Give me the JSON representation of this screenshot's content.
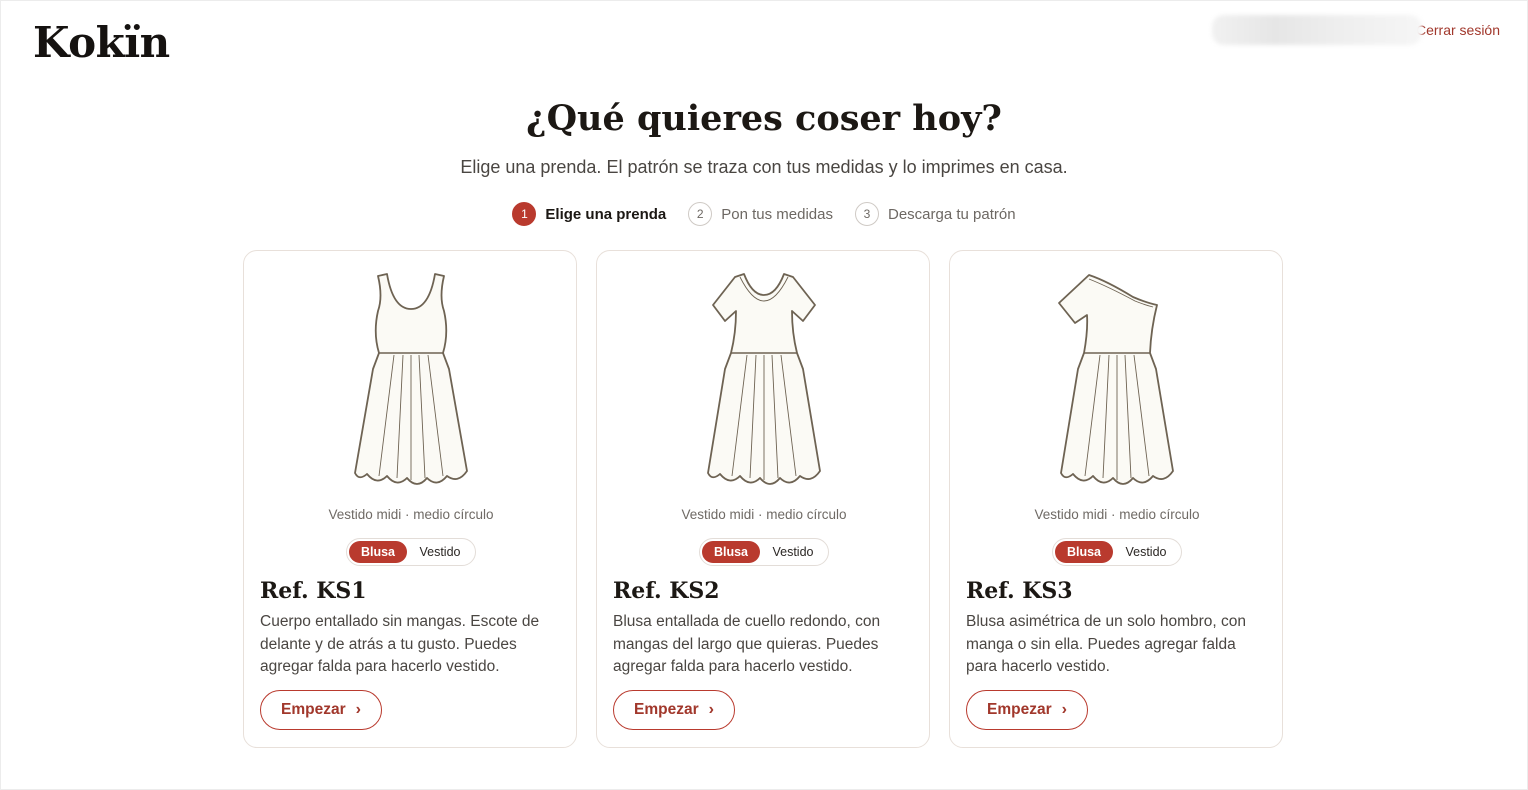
{
  "header": {
    "logo": "Kokïn",
    "logout_label": "Cerrar sesión"
  },
  "intro": {
    "title": "¿Qué quieres coser hoy?",
    "subtitle": "Elige una prenda. El patrón se traza con tus medidas y lo imprimes en casa."
  },
  "steps": [
    {
      "number": "1",
      "label": "Elige una prenda",
      "active": true
    },
    {
      "number": "2",
      "label": "Pon tus medidas",
      "active": false
    },
    {
      "number": "3",
      "label": "Descarga tu patrón",
      "active": false
    }
  ],
  "cards": [
    {
      "illustration": "sleeveless-dress-icon",
      "caption": "Vestido midi · medio círculo",
      "toggle": {
        "selected": "Blusa",
        "other": "Vestido"
      },
      "ref": "Ref. KS1",
      "description": "Cuerpo entallado sin mangas. Escote de delante y de atrás a tu gusto. Puedes agregar falda para hacerlo vestido.",
      "button_label": "Empezar"
    },
    {
      "illustration": "short-sleeve-dress-icon",
      "caption": "Vestido midi · medio círculo",
      "toggle": {
        "selected": "Blusa",
        "other": "Vestido"
      },
      "ref": "Ref. KS2",
      "description": "Blusa entallada de cuello redondo, con mangas del largo que quieras. Puedes agregar falda para hacerlo vestido.",
      "button_label": "Empezar"
    },
    {
      "illustration": "one-shoulder-dress-icon",
      "caption": "Vestido midi · medio círculo",
      "toggle": {
        "selected": "Blusa",
        "other": "Vestido"
      },
      "ref": "Ref. KS3",
      "description": "Blusa asimétrica de un solo hombro, con manga o sin ella. Puedes agregar falda para hacerlo vestido.",
      "button_label": "Empezar"
    }
  ],
  "colors": {
    "accent": "#b93a2e",
    "text": "#1c1814",
    "muted": "#6f6a65",
    "card_border": "#e8e0da"
  }
}
